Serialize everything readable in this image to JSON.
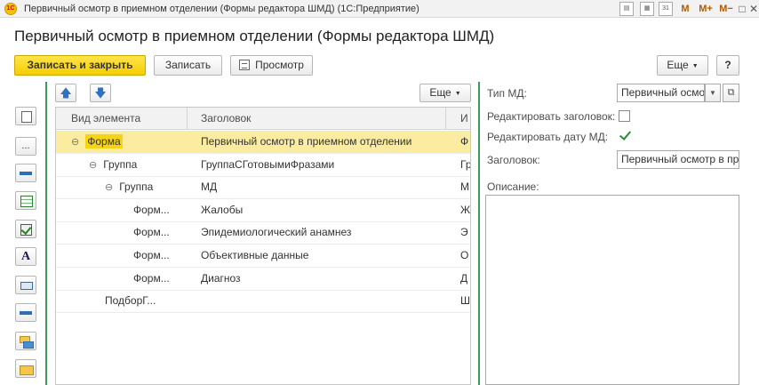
{
  "window": {
    "app_logo_text": "1С",
    "title": "Первичный осмотр в приемном отделении (Формы редактора ШМД)  (1С:Предприятие)",
    "mem_m": "M",
    "mem_mplus": "M+",
    "mem_mminus": "M−",
    "restore_glyph": "□",
    "close_glyph": "✕"
  },
  "form": {
    "title": "Первичный осмотр в приемном отделении (Формы редактора ШМД)"
  },
  "toolbar": {
    "write_close_label": "Записать и закрыть",
    "write_label": "Записать",
    "preview_label": "Просмотр",
    "more_label": "Еще",
    "help_label": "?"
  },
  "table_toolbar": {
    "up_glyph": "🡅",
    "down_glyph": "🡇",
    "more_label": "Еще"
  },
  "side_buttons": {
    "ellipsis": "...",
    "text_a": "A"
  },
  "grid": {
    "columns": [
      "Вид элемента",
      "Заголовок",
      "И"
    ],
    "rows": [
      {
        "type": "Форма",
        "caption": "Первичный осмотр в приемном отделении",
        "extra": "Ф",
        "level": 0,
        "toggle": "⊖",
        "selected": true
      },
      {
        "type": "Группа",
        "caption": "ГруппаСГотовымиФразами",
        "extra": "Гр",
        "level": 1,
        "toggle": "⊖",
        "selected": false
      },
      {
        "type": "Группа",
        "caption": "МД",
        "extra": "М",
        "level": 2,
        "toggle": "⊖",
        "selected": false
      },
      {
        "type": "Форм...",
        "caption": "Жалобы",
        "extra": "Ж",
        "level": 3,
        "toggle": "",
        "selected": false
      },
      {
        "type": "Форм...",
        "caption": "Эпидемиологический анамнез",
        "extra": "Э",
        "level": 3,
        "toggle": "",
        "selected": false
      },
      {
        "type": "Форм...",
        "caption": "Объективные данные",
        "extra": "О",
        "level": 3,
        "toggle": "",
        "selected": false
      },
      {
        "type": "Форм...",
        "caption": "Диагноз",
        "extra": "Д",
        "level": 3,
        "toggle": "",
        "selected": false
      },
      {
        "type": "ПодборГ...",
        "caption": "",
        "extra": "Ш",
        "level": 2,
        "toggle": "",
        "selected": false
      }
    ]
  },
  "props": {
    "md_type_label": "Тип МД:",
    "md_type_value": "Первичный осмо",
    "edit_caption_label": "Редактировать заголовок:",
    "edit_caption_checked": false,
    "edit_md_date_label": "Редактировать дату МД:",
    "edit_md_date_checked": true,
    "caption_label": "Заголовок:",
    "caption_value": "Первичный осмотр в пр",
    "description_label": "Описание:",
    "description_value": ""
  },
  "colors": {
    "accent_green": "#3c9a5f",
    "primary_button": "#f5cd00",
    "selected_row": "#fbeca0",
    "highlight": "#f7d316"
  }
}
